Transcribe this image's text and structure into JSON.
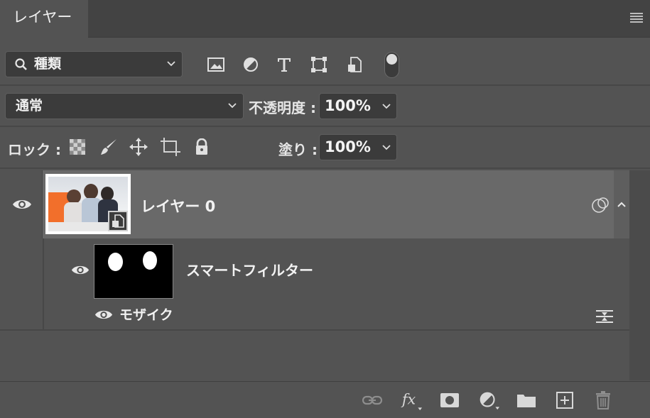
{
  "panel": {
    "tab_label": "レイヤー",
    "menu_icon": "hamburger-menu-icon"
  },
  "filter_row": {
    "kind_label": "種類",
    "filter_icons": [
      "image-filter-icon",
      "adjustment-filter-icon",
      "type-filter-icon",
      "shape-filter-icon",
      "smart-object-filter-icon"
    ],
    "toggle_icon": "filter-toggle-icon"
  },
  "blend_row": {
    "blend_mode": "通常",
    "opacity_label": "不透明度 :",
    "opacity_value": "100%"
  },
  "lock_row": {
    "lock_label": "ロック :",
    "lock_icons": [
      "lock-transparent-pixels-icon",
      "lock-image-pixels-icon",
      "lock-position-icon",
      "lock-artboard-icon",
      "lock-all-icon"
    ],
    "fill_label": "塗り :",
    "fill_value": "100%"
  },
  "layers": [
    {
      "name": "レイヤー 0",
      "visible": true,
      "selected": true,
      "type": "smart-object"
    }
  ],
  "smart_filters": {
    "label": "スマートフィルター",
    "filters": [
      {
        "name": "モザイク",
        "visible": true
      }
    ]
  },
  "footer_icons": [
    "link-layers-icon",
    "fx-icon",
    "add-mask-icon",
    "adjustment-layer-icon",
    "new-group-icon",
    "new-layer-icon",
    "delete-icon"
  ],
  "colors": {
    "panel_bg": "#535353",
    "selected_row": "#696969",
    "tab_bar": "#434343"
  }
}
